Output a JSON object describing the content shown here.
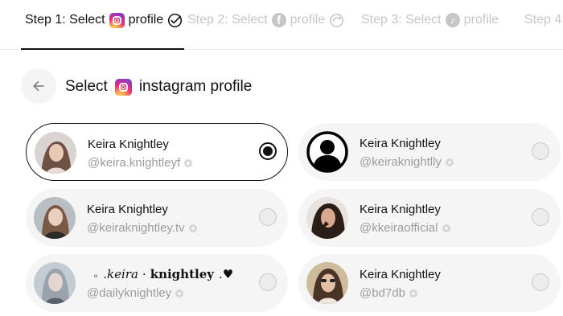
{
  "steps": [
    {
      "prefix": "Step 1: Select",
      "suffix": "profile",
      "platform_icon": "instagram-icon",
      "status_icon": "check-circle-icon",
      "state": "active"
    },
    {
      "prefix": "Step 2: Select",
      "suffix": "profile",
      "platform_icon": "facebook-icon",
      "status_icon": "spinner-icon",
      "state": "inactive"
    },
    {
      "prefix": "Step 3: Select",
      "suffix": "profile",
      "platform_icon": "tiktok-icon",
      "status_icon": "",
      "state": "inactive"
    },
    {
      "prefix": "Step 4:",
      "suffix": "",
      "platform_icon": "",
      "status_icon": "",
      "state": "inactive"
    }
  ],
  "header": {
    "back_icon": "arrow-left-icon",
    "title_prefix": "Select",
    "title_suffix": "instagram profile"
  },
  "profiles": [
    {
      "name": "Keira Knightley",
      "handle": "@keira.knightleyf",
      "selected": true
    },
    {
      "name": "Keira Knightley",
      "handle": "@keiraknightlly",
      "selected": false
    },
    {
      "name": "Keira Knightley",
      "handle": "@keiraknightley.tv",
      "selected": false
    },
    {
      "name": "Keira Knightley",
      "handle": "@kkeiraofficial",
      "selected": false
    },
    {
      "name_parts": [
        "ₒ",
        ".keira",
        "·",
        "knightley",
        ".♥"
      ],
      "handle": "@dailyknightley",
      "selected": false
    },
    {
      "name": "Keira Knightley",
      "handle": "@bd7db",
      "selected": false
    }
  ],
  "colors": {
    "accent": "#111111",
    "muted": "#c6c6c6",
    "card_bg": "#f5f5f5"
  }
}
